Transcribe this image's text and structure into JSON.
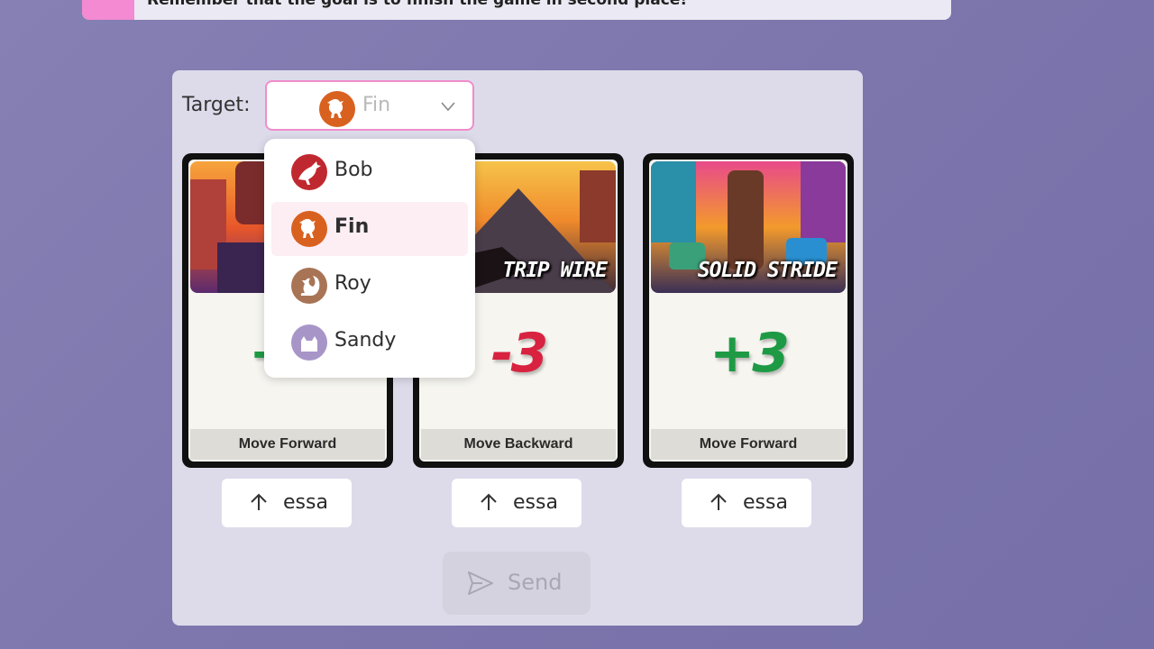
{
  "banner": {
    "message": "Remember that the goal is to finish the game in second place!"
  },
  "target": {
    "label": "Target:",
    "selected": "Fin",
    "options": [
      {
        "label": "Bob",
        "color": "#c0282f",
        "icon": "bird-icon"
      },
      {
        "label": "Fin",
        "color": "#d9611f",
        "icon": "chick-icon"
      },
      {
        "label": "Roy",
        "color": "#a87455",
        "icon": "squirrel-icon"
      },
      {
        "label": "Sandy",
        "color": "#a895c8",
        "icon": "cat-icon"
      }
    ]
  },
  "cards": [
    {
      "title": "",
      "value": "+3",
      "value_color": "#1e9a45",
      "footer": "Move Forward",
      "button": "essa"
    },
    {
      "title": "TRIP WIRE",
      "value": "-3",
      "value_color": "#d8223f",
      "footer": "Move Backward",
      "button": "essa"
    },
    {
      "title": "SOLID STRIDE",
      "value": "+3",
      "value_color": "#1e9a45",
      "footer": "Move Forward",
      "button": "essa"
    }
  ],
  "send": {
    "label": "Send"
  }
}
